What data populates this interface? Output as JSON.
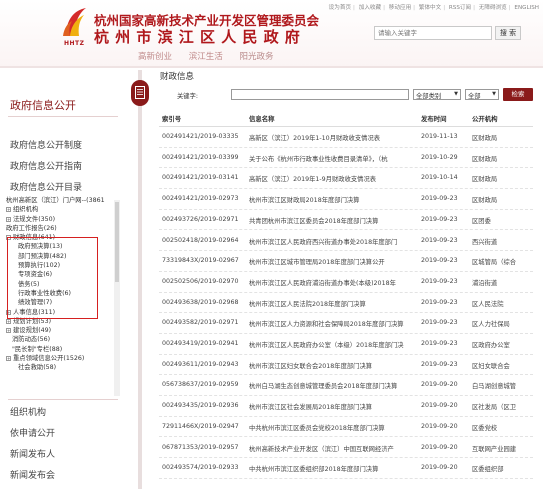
{
  "header": {
    "logo_text": "HHTZ",
    "title_line1": "杭州国家高新技术产业开发区管理委员会",
    "title_line2": "杭州市滨江区人民政府",
    "top_links": [
      "设为首页",
      "加入收藏",
      "移动应用",
      "繁体中文",
      "RSS订阅",
      "无障碍浏览",
      "ENGLISH"
    ],
    "search_placeholder": "请输入关键字",
    "search_button": "搜 索",
    "nav": [
      "高新创业",
      "滨江生活",
      "阳光政务"
    ]
  },
  "sidebar": {
    "heading": "政府信息公开",
    "links": [
      "政府信息公开制度",
      "政府信息公开指南",
      "政府信息公开目录"
    ],
    "tree": [
      {
        "level": 1,
        "pm": "",
        "label": "杭州高新区（滨江）门户网--(3861"
      },
      {
        "level": 1,
        "pm": "+",
        "label": "组织机构"
      },
      {
        "level": 1,
        "pm": "+",
        "label": "法规文件(350)"
      },
      {
        "level": 1,
        "pm": "",
        "label": "政府工作报告(26)"
      },
      {
        "level": 1,
        "pm": "-",
        "label": "财政信息(641)"
      },
      {
        "level": 3,
        "pm": "",
        "label": "政府预决算(13)"
      },
      {
        "level": 3,
        "pm": "",
        "label": "部门预决算(482)"
      },
      {
        "level": 3,
        "pm": "",
        "label": "预算执行(102)"
      },
      {
        "level": 3,
        "pm": "",
        "label": "专项资金(6)"
      },
      {
        "level": 3,
        "pm": "",
        "label": "债务(5)"
      },
      {
        "level": 3,
        "pm": "",
        "label": "行政事业性收费(6)"
      },
      {
        "level": 3,
        "pm": "",
        "label": "绩效管理(7)"
      },
      {
        "level": 1,
        "pm": "+",
        "label": "人事信息(311)"
      },
      {
        "level": 1,
        "pm": "+",
        "label": "规划计划(53)"
      },
      {
        "level": 1,
        "pm": "+",
        "label": "建设规划(49)"
      },
      {
        "level": 2,
        "pm": "",
        "label": "消防动态(56)"
      },
      {
        "level": 2,
        "pm": "",
        "label": "\"民长制\"专栏(88)"
      },
      {
        "level": 1,
        "pm": "+",
        "label": "重点领域信息公开(1526)"
      },
      {
        "level": 3,
        "pm": "",
        "label": "社会救助(58)"
      }
    ],
    "bottom_links": [
      "组织机构",
      "依申请公开",
      "新闻发布人",
      "新闻发布会"
    ]
  },
  "main": {
    "title": "财政信息",
    "keyword_label": "关键字:",
    "category_select": "全部类别",
    "scope_select": "全部",
    "search_button": "检索",
    "columns": [
      "索引号",
      "信息名称",
      "发布时间",
      "公开机构"
    ],
    "rows": [
      {
        "id": "002491421/2019-03335",
        "name": "高新区（滨江）2019年1-10月财政收支情况表",
        "date": "2019-11-13",
        "org": "区财政局"
      },
      {
        "id": "002491421/2019-03399",
        "name": "关于公布《杭州市行政事业性收费目录清单》，（杭",
        "date": "2019-10-29",
        "org": "区财政局"
      },
      {
        "id": "002491421/2019-03141",
        "name": "高新区（滨江）2019年1-9月财政收支情况表",
        "date": "2019-10-14",
        "org": "区财政局"
      },
      {
        "id": "002491421/2019-02973",
        "name": "杭州市滨江区财政局2018年度部门决算",
        "date": "2019-09-23",
        "org": "区财政局"
      },
      {
        "id": "002493726/2019-02971",
        "name": "共青团杭州市滨江区委员会2018年度部门决算",
        "date": "2019-09-23",
        "org": "区团委"
      },
      {
        "id": "002502418/2019-02964",
        "name": "杭州市滨江区人民政府西兴街道办事处2018年度部门",
        "date": "2019-09-23",
        "org": "西兴街道"
      },
      {
        "id": "73319843X/2019-02967",
        "name": "杭州市滨江区城市管理局2018年度部门决算公开",
        "date": "2019-09-23",
        "org": "区城管局（综合"
      },
      {
        "id": "002502506/2019-02970",
        "name": "杭州市滨江区人民政府浦沿街道办事处(本级)2018年",
        "date": "2019-09-23",
        "org": "浦沿街道"
      },
      {
        "id": "002493638/2019-02968",
        "name": "杭州市滨江区人民法院2018年度部门决算",
        "date": "2019-09-23",
        "org": "区人民法院"
      },
      {
        "id": "002493582/2019-02971",
        "name": "杭州市滨江区人力资源和社会保障局2018年度部门决算",
        "date": "2019-09-23",
        "org": "区人力社保局"
      },
      {
        "id": "002493419/2019-02941",
        "name": "杭州市滨江区人民政府办公室（本级）2018年度部门决",
        "date": "2019-09-23",
        "org": "区政府办公室"
      },
      {
        "id": "002493611/2019-02943",
        "name": "杭州市滨江区妇女联合会2018年度部门决算",
        "date": "2019-09-23",
        "org": "区妇女联合会"
      },
      {
        "id": "056738637/2019-02959",
        "name": "杭州白马湖生态创意城管理委员会2018年度部门决算",
        "date": "2019-09-20",
        "org": "白马湖创意城管"
      },
      {
        "id": "002493435/2019-02936",
        "name": "杭州市滨江区社会发展局2018年度部门决算",
        "date": "2019-09-20",
        "org": "区社发局（区卫"
      },
      {
        "id": "72911466X/2019-02947",
        "name": "中共杭州市滨江区委员会党校2018年度部门决算",
        "date": "2019-09-20",
        "org": "区委党校"
      },
      {
        "id": "067871353/2019-02957",
        "name": "杭州高新技术产业开发区（滨江）中国互联网经济产",
        "date": "2019-09-20",
        "org": "互联网产业园建"
      },
      {
        "id": "002493574/2019-02933",
        "name": "中共杭州市滨江区委组织部2018年度部门决算",
        "date": "2019-09-20",
        "org": "区委组织部"
      }
    ]
  },
  "colors": {
    "brand": "#8a1a1a",
    "title": "#b0181c",
    "highlight_box": "#d52020"
  }
}
